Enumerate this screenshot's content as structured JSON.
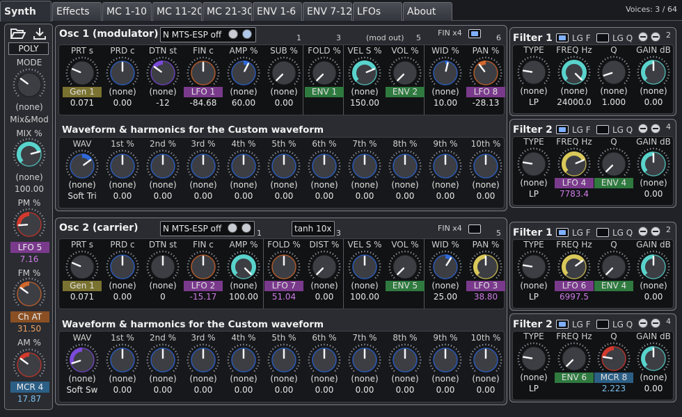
{
  "tabs": [
    {
      "label": "Synth",
      "active": true
    },
    {
      "label": "Effects"
    },
    {
      "label": "MC 1-10"
    },
    {
      "label": "MC 11-20"
    },
    {
      "label": "MC 21-30"
    },
    {
      "label": "ENV 1-6"
    },
    {
      "label": "ENV 7-12"
    },
    {
      "label": "LFOs"
    },
    {
      "label": "About"
    }
  ],
  "voices": "Voices: 3 / 64",
  "colors": {
    "teal": "#59d3cc",
    "blue": "#2f68d8",
    "purple": "#7b4ad8",
    "orange": "#d2682e",
    "yellow": "#d9c85a",
    "red": "#d23a2e"
  },
  "left": {
    "open_icon": "folder-open-icon",
    "save_icon": "download-icon",
    "poly": "POLY",
    "mode_label": "MODE",
    "mode_mod": "(none)",
    "mixmod": "Mix&Mod",
    "mix_label": "MIX %",
    "mix_mod": "(none)",
    "mix_val": "100.00",
    "pm_label": "PM %",
    "pm_mod": "LFO 5",
    "pm_val": "7.16",
    "fm_label": "FM %",
    "fm_mod": "Ch AT",
    "fm_val": "31.50",
    "am_label": "AM %",
    "am_mod": "MCR 4",
    "am_val": "17.87"
  },
  "osc1": {
    "title": "Osc 1 (modulator)",
    "mts": "N MTS-ESP off",
    "fin": "FIN x4",
    "modout": "(mod out)",
    "nums": [
      "1",
      "3",
      "5",
      "6"
    ],
    "knobs": [
      {
        "label": "PRT s",
        "mod": "Gen 1",
        "mt": "gen",
        "val": "0.071",
        "c": "grey",
        "a": 0.25
      },
      {
        "label": "PRD c",
        "mod": "(none)",
        "val": "0.00",
        "c": "blue",
        "a": 0.5
      },
      {
        "label": "DTN st",
        "mod": "(none)",
        "val": "-12",
        "c": "purple",
        "a": 0.3
      },
      {
        "label": "FIN c",
        "mod": "LFO 1",
        "mt": "lfo",
        "val": "-84.68",
        "c": "orange",
        "a": 0.5
      },
      {
        "label": "AMP %",
        "mod": "(none)",
        "val": "60.00",
        "c": "blue",
        "a": 0.6
      },
      {
        "label": "SUB %",
        "mod": "(none)",
        "val": "0.00",
        "c": "grey",
        "a": 0
      },
      {
        "label": "FOLD %",
        "mod": "ENV 1",
        "mt": "env",
        "val": "",
        "c": "grey",
        "a": 0
      },
      {
        "label": "VEL S %",
        "mod": "(none)",
        "val": "150.00",
        "c": "teal",
        "a": 0.75
      },
      {
        "label": "VOL %",
        "mod": "ENV 2",
        "mt": "env",
        "val": "",
        "c": "grey",
        "a": 0
      },
      {
        "label": "WID %",
        "mod": "(none)",
        "val": "10.00",
        "c": "blue",
        "a": 0.55
      },
      {
        "label": "PAN %",
        "mod": "LFO 8",
        "mt": "lfo",
        "val": "-28.13",
        "c": "orange",
        "a": 0.36
      }
    ],
    "wf_title": "Waveform & harmonics for the Custom waveform",
    "wf": [
      {
        "label": "WAV",
        "mod": "(none)",
        "val": "Soft Tri",
        "c": "blue",
        "a": 0.7
      },
      {
        "label": "1st %",
        "mod": "(none)",
        "val": "0.00",
        "c": "blue",
        "a": 0.5
      },
      {
        "label": "2nd %",
        "mod": "(none)",
        "val": "0.00",
        "c": "blue",
        "a": 0.5
      },
      {
        "label": "3rd %",
        "mod": "(none)",
        "val": "0.00",
        "c": "blue",
        "a": 0.5
      },
      {
        "label": "4th %",
        "mod": "(none)",
        "val": "0.00",
        "c": "blue",
        "a": 0.5
      },
      {
        "label": "5th %",
        "mod": "(none)",
        "val": "0.00",
        "c": "blue",
        "a": 0.5
      },
      {
        "label": "6th %",
        "mod": "(none)",
        "val": "0.00",
        "c": "blue",
        "a": 0.5
      },
      {
        "label": "7th %",
        "mod": "(none)",
        "val": "0.00",
        "c": "blue",
        "a": 0.5
      },
      {
        "label": "8th %",
        "mod": "(none)",
        "val": "0.00",
        "c": "blue",
        "a": 0.5
      },
      {
        "label": "9th %",
        "mod": "(none)",
        "val": "0.00",
        "c": "blue",
        "a": 0.5
      },
      {
        "label": "10th %",
        "mod": "(none)",
        "val": "0.00",
        "c": "blue",
        "a": 0.5
      }
    ],
    "f1": {
      "title": "Filter 1",
      "lgf": "LG F",
      "lgq": "LG Q",
      "num": "2",
      "type_mod": "(none)",
      "type_val": "LP",
      "knobs": [
        {
          "label": "FREQ Hz",
          "mod": "(none)",
          "val": "24000.0",
          "c": "teal",
          "a": 1
        },
        {
          "label": "Q",
          "mod": "(none)",
          "val": "1.000",
          "c": "grey",
          "a": 0.1
        },
        {
          "label": "GAIN dB",
          "mod": "(none)",
          "val": "0.00",
          "c": "teal",
          "a": 0.5
        }
      ]
    },
    "f2": {
      "title": "Filter 2",
      "lgf": "LG F",
      "lgq": "LG Q",
      "num": "4",
      "type_mod": "(none)",
      "type_val": "LP",
      "knobs": [
        {
          "label": "FREQ Hz",
          "mod": "LFO 4",
          "mt": "lfo",
          "val": "7783.4",
          "vc": "lfo",
          "c": "yellow",
          "a": 0.75
        },
        {
          "label": "Q",
          "mod": "ENV 4",
          "mt": "env",
          "val": "",
          "c": "grey",
          "a": 0
        },
        {
          "label": "GAIN dB",
          "mod": "(none)",
          "val": "0.00",
          "c": "teal",
          "a": 0.5
        }
      ]
    }
  },
  "osc2": {
    "title": "Osc 2 (carrier)",
    "mts": "N MTS-ESP off",
    "tanh": "tanh 10x",
    "fin": "FIN x4",
    "nums": [
      "1",
      "3",
      "5"
    ],
    "knobs": [
      {
        "label": "PRT s",
        "mod": "Gen 1",
        "mt": "gen",
        "val": "0.071",
        "c": "grey",
        "a": 0.25
      },
      {
        "label": "PRD c",
        "mod": "(none)",
        "val": "0.00",
        "c": "blue",
        "a": 0.5
      },
      {
        "label": "DTN st",
        "mod": "(none)",
        "val": "0",
        "c": "grey",
        "a": 0.5
      },
      {
        "label": "FIN c",
        "mod": "LFO 2",
        "mt": "lfo",
        "val": "-15.17",
        "vc": "lfo",
        "c": "orange",
        "a": 0.5
      },
      {
        "label": "AMP %",
        "mod": "(none)",
        "val": "100.00",
        "c": "teal",
        "a": 1
      },
      {
        "label": "FOLD %",
        "mod": "LFO 7",
        "mt": "lfo",
        "val": "51.04",
        "vc": "lfo",
        "c": "orange",
        "a": 0.5
      },
      {
        "label": "DIST %",
        "mod": "(none)",
        "val": "0.00",
        "c": "grey",
        "a": 0
      },
      {
        "label": "VEL S %",
        "mod": "(none)",
        "val": "100.00",
        "c": "blue",
        "a": 0.5
      },
      {
        "label": "VOL %",
        "mod": "ENV 5",
        "mt": "env",
        "val": "",
        "c": "grey",
        "a": 0
      },
      {
        "label": "WID %",
        "mod": "(none)",
        "val": "25.00",
        "c": "blue",
        "a": 0.62
      },
      {
        "label": "PAN %",
        "mod": "LFO 3",
        "mt": "lfo",
        "val": "38.80",
        "vc": "lfo",
        "c": "yellow",
        "a": 0.5
      }
    ],
    "wf_title": "Waveform & harmonics for the Custom waveform",
    "wf": [
      {
        "label": "WAV",
        "mod": "(none)",
        "val": "Soft Sw",
        "c": "purple",
        "a": 0.1
      },
      {
        "label": "1st %",
        "mod": "(none)",
        "val": "0.00",
        "c": "blue",
        "a": 0.5
      },
      {
        "label": "2nd %",
        "mod": "(none)",
        "val": "0.00",
        "c": "blue",
        "a": 0.5
      },
      {
        "label": "3rd %",
        "mod": "(none)",
        "val": "0.00",
        "c": "blue",
        "a": 0.5
      },
      {
        "label": "4th %",
        "mod": "(none)",
        "val": "0.00",
        "c": "blue",
        "a": 0.5
      },
      {
        "label": "5th %",
        "mod": "(none)",
        "val": "0.00",
        "c": "blue",
        "a": 0.5
      },
      {
        "label": "6th %",
        "mod": "(none)",
        "val": "0.00",
        "c": "blue",
        "a": 0.5
      },
      {
        "label": "7th %",
        "mod": "(none)",
        "val": "0.00",
        "c": "blue",
        "a": 0.5
      },
      {
        "label": "8th %",
        "mod": "(none)",
        "val": "0.00",
        "c": "blue",
        "a": 0.5
      },
      {
        "label": "9th %",
        "mod": "(none)",
        "val": "0.00",
        "c": "blue",
        "a": 0.5
      },
      {
        "label": "10th %",
        "mod": "(none)",
        "val": "0.00",
        "c": "blue",
        "a": 0.5
      }
    ],
    "f1": {
      "title": "Filter 1",
      "lgf": "LG F",
      "lgq": "LG Q",
      "num": "2",
      "type_mod": "(none)",
      "type_val": "LP",
      "knobs": [
        {
          "label": "FREQ Hz",
          "mod": "LFO 6",
          "mt": "lfo",
          "val": "6997.5",
          "vc": "lfo",
          "c": "yellow",
          "a": 0.7
        },
        {
          "label": "Q",
          "mod": "ENV 4",
          "mt": "env",
          "val": "",
          "c": "grey",
          "a": 0
        },
        {
          "label": "GAIN dB",
          "mod": "(none)",
          "val": "0.00",
          "c": "teal",
          "a": 0.5
        }
      ]
    },
    "f2": {
      "title": "Filter 2",
      "lgf": "LG F",
      "lgq": "LG Q",
      "num": "4",
      "type_mod": "(none)",
      "type_val": "LP",
      "knobs": [
        {
          "label": "FREQ Hz",
          "mod": "ENV 6",
          "mt": "env",
          "val": "",
          "c": "grey",
          "a": 0
        },
        {
          "label": "Q",
          "mod": "MCR 8",
          "mt": "mcr",
          "val": "2.223",
          "vc": "mcr",
          "c": "red",
          "a": 0.2
        },
        {
          "label": "GAIN dB",
          "mod": "(none)",
          "val": "0.00",
          "c": "teal",
          "a": 0.5
        }
      ]
    }
  }
}
